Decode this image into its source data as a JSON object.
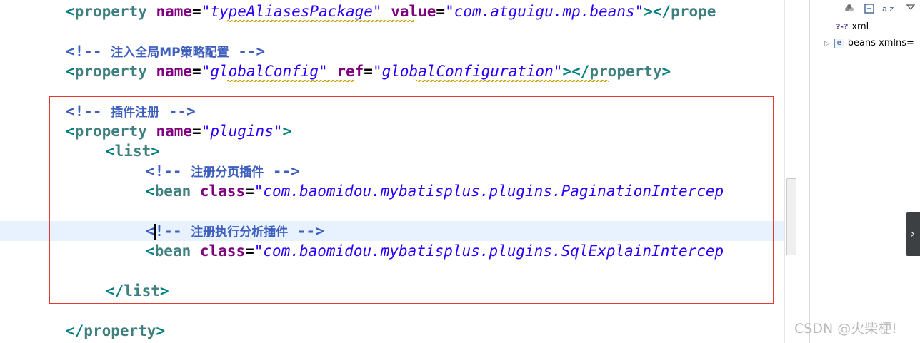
{
  "editor": {
    "lines": [
      {
        "id": "l1",
        "tokens": [
          [
            "bracket",
            "<"
          ],
          [
            "tag",
            "property "
          ],
          [
            "attr",
            "name"
          ],
          [
            "eq",
            "="
          ],
          [
            "str",
            "\"typeAliasesPackage\""
          ],
          [
            "attr",
            " value"
          ],
          [
            "eq",
            "="
          ],
          [
            "str",
            "\"com.atguigu.mp.beans\""
          ],
          [
            "bracket",
            "></"
          ],
          [
            "tag",
            "prope"
          ]
        ]
      },
      {
        "id": "l2",
        "tokens": []
      },
      {
        "id": "l3",
        "tokens": [
          [
            "comment",
            "<!-- "
          ],
          [
            "ctext",
            "注入全局MP策略配置"
          ],
          [
            "comment",
            " -->"
          ]
        ]
      },
      {
        "id": "l4",
        "tokens": [
          [
            "bracket",
            "<"
          ],
          [
            "tag",
            "property "
          ],
          [
            "attr",
            "name"
          ],
          [
            "eq",
            "="
          ],
          [
            "str",
            "\"globalConfig\""
          ],
          [
            "attr",
            " ref"
          ],
          [
            "eq",
            "="
          ],
          [
            "str",
            "\"globalConfiguration\""
          ],
          [
            "bracket",
            "></"
          ],
          [
            "tag",
            "property"
          ],
          [
            "bracket",
            ">"
          ]
        ]
      },
      {
        "id": "l5",
        "tokens": []
      },
      {
        "id": "l6",
        "tokens": [
          [
            "comment",
            "<!-- "
          ],
          [
            "ctext",
            "插件注册"
          ],
          [
            "comment",
            " -->"
          ]
        ]
      },
      {
        "id": "l7",
        "tokens": [
          [
            "bracket",
            "<"
          ],
          [
            "tag",
            "property "
          ],
          [
            "attr",
            "name"
          ],
          [
            "eq",
            "="
          ],
          [
            "str",
            "\"plugins\""
          ],
          [
            "bracket",
            ">"
          ]
        ]
      },
      {
        "id": "l8",
        "tokens": [
          [
            "bracket",
            "<"
          ],
          [
            "tag",
            "list"
          ],
          [
            "bracket",
            ">"
          ]
        ]
      },
      {
        "id": "l9",
        "tokens": [
          [
            "comment",
            "<!-- "
          ],
          [
            "ctext",
            "注册分页插件"
          ],
          [
            "comment",
            " -->"
          ]
        ]
      },
      {
        "id": "l10",
        "tokens": [
          [
            "bracket",
            "<"
          ],
          [
            "tag",
            "bean "
          ],
          [
            "attr",
            "class"
          ],
          [
            "eq",
            "="
          ],
          [
            "str",
            "\"com.baomidou.mybatisplus.plugins.PaginationIntercep"
          ]
        ]
      },
      {
        "id": "l11",
        "tokens": []
      },
      {
        "id": "l12",
        "tokens": [
          [
            "comment",
            "<"
          ],
          [
            "caret",
            ""
          ],
          [
            "comment",
            "!-- "
          ],
          [
            "ctext",
            "注册执行分析插件"
          ],
          [
            "comment",
            " -->"
          ]
        ]
      },
      {
        "id": "l13",
        "tokens": [
          [
            "bracket",
            "<"
          ],
          [
            "tag",
            "bean "
          ],
          [
            "attr",
            "class"
          ],
          [
            "eq",
            "="
          ],
          [
            "str",
            "\"com.baomidou.mybatisplus.plugins.SqlExplainIntercep"
          ]
        ]
      },
      {
        "id": "l14",
        "tokens": []
      },
      {
        "id": "l15",
        "tokens": [
          [
            "bracket",
            "</"
          ],
          [
            "tag",
            "list"
          ],
          [
            "bracket",
            ">"
          ]
        ]
      },
      {
        "id": "l16",
        "tokens": []
      },
      {
        "id": "l17",
        "tokens": [
          [
            "bracket",
            "</"
          ],
          [
            "tag",
            "property"
          ],
          [
            "bracket",
            ">"
          ]
        ]
      }
    ]
  },
  "outline": {
    "toolbar_icons": [
      "filter-icon",
      "collapse-all-icon",
      "sort-icon",
      "view-menu-icon"
    ],
    "sort_icon_label": "a z",
    "items": [
      {
        "icon": "processing-instruction-icon",
        "icon_text": "?-?",
        "label": "xml"
      },
      {
        "icon": "element-icon",
        "icon_text": "e",
        "label": "beans xmlns="
      }
    ]
  },
  "side_handle": {
    "glyph": "›"
  },
  "watermark": "CSDN @火柴梗!"
}
